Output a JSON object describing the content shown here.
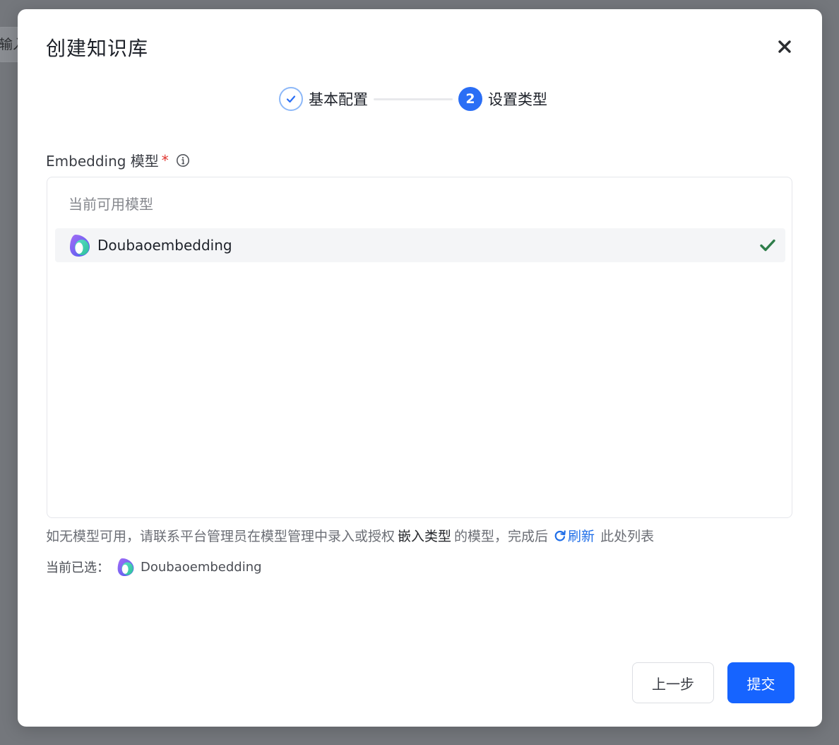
{
  "background": {
    "input_text": "输入"
  },
  "modal": {
    "title": "创建知识库",
    "close_icon": "close-icon"
  },
  "steps": [
    {
      "label": "基本配置",
      "state": "done",
      "icon": "check-icon"
    },
    {
      "number": "2",
      "label": "设置类型",
      "state": "active"
    }
  ],
  "field": {
    "label": "Embedding 模型",
    "required_mark": "*",
    "info_icon": "info-icon"
  },
  "model_list": {
    "group_label": "当前可用模型",
    "items": [
      {
        "name": "Doubaoembedding",
        "icon": "doubao-logo-icon",
        "selected": true
      }
    ]
  },
  "hint": {
    "prefix": "如无模型可用，请联系平台管理员在模型管理中录入或授权",
    "emphasis": "嵌入类型",
    "middle": "的模型，完成后",
    "refresh_label": "刷新",
    "suffix": "此处列表"
  },
  "current_selection": {
    "label": "当前已选：",
    "name": "Doubaoembedding"
  },
  "footer": {
    "prev_label": "上一步",
    "submit_label": "提交"
  },
  "colors": {
    "primary": "#1664ff",
    "step_active": "#2a6ef5",
    "check_green": "#2e7d4a",
    "required": "#e0342d",
    "link": "#1f6ee8"
  }
}
